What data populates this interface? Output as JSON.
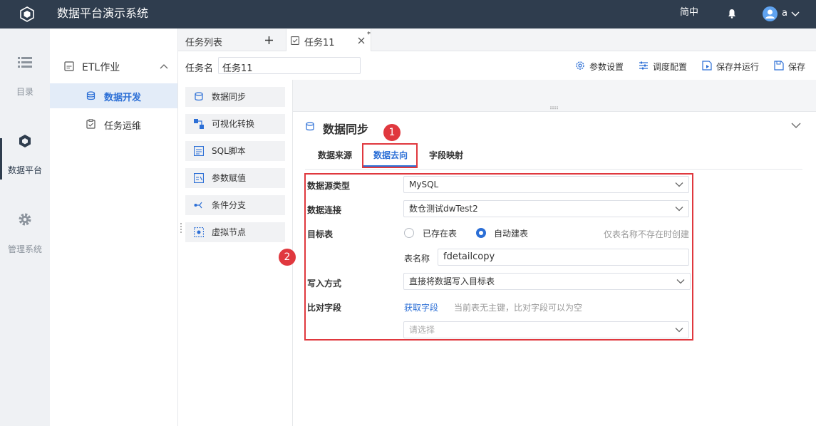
{
  "app": {
    "title": "数据平台演示系统",
    "lang": "简中",
    "user": "a"
  },
  "leftnav": {
    "items": [
      {
        "label": "目录",
        "icon": "list-icon"
      },
      {
        "label": "数据平台",
        "icon": "cube-icon"
      },
      {
        "label": "管理系统",
        "icon": "gear-icon"
      }
    ]
  },
  "submenu": {
    "group": "ETL作业",
    "items": [
      "数据开发",
      "任务运维"
    ]
  },
  "tabs": {
    "list_label": "任务列表",
    "task_tab": "任务11",
    "modified_mark": "*"
  },
  "task": {
    "name_label": "任务名",
    "name_value": "任务11"
  },
  "toolbar": {
    "params": "参数设置",
    "schedule": "调度配置",
    "save_run": "保存并运行",
    "save": "保存"
  },
  "palette": [
    "数据同步",
    "可视化转换",
    "SQL脚本",
    "参数赋值",
    "条件分支",
    "虚拟节点"
  ],
  "panel": {
    "title": "数据同步",
    "tabs": [
      "数据来源",
      "数据去向",
      "字段映射"
    ],
    "active_tab": "数据去向",
    "form": {
      "source_type_label": "数据源类型",
      "source_type_value": "MySQL",
      "connection_label": "数据连接",
      "connection_value": "数仓测试dwTest2",
      "target_label": "目标表",
      "radio_existing": "已存在表",
      "radio_auto": "自动建表",
      "radio_hint": "仅表名称不存在时创建",
      "table_name_label": "表名称",
      "table_name_value": "fdetailcopy",
      "write_mode_label": "写入方式",
      "write_mode_value": "直接将数据写入目标表",
      "compare_label": "比对字段",
      "fetch_fields": "获取字段",
      "compare_hint": "当前表无主键，比对字段可以为空",
      "select_placeholder": "请选择"
    }
  },
  "badges": [
    "1",
    "2"
  ],
  "colors": {
    "topbar": "#2f3d4e",
    "accent": "#2c6fd6",
    "highlight": "#e0383e"
  }
}
